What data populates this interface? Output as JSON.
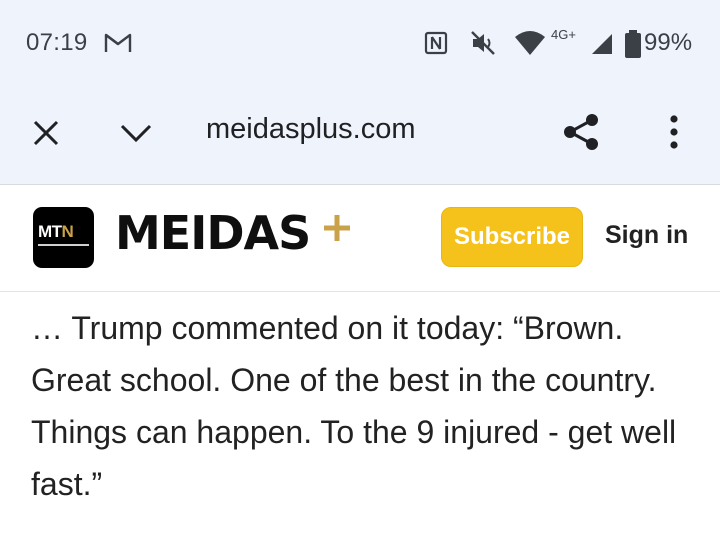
{
  "status_bar": {
    "time": "07:19",
    "network_type": "4G+",
    "battery_percent": "99%",
    "icons": [
      "gmail-icon",
      "nfc-icon",
      "mute-icon",
      "wifi-icon",
      "signal-icon",
      "battery-icon"
    ]
  },
  "browser": {
    "url": "meidasplus.com",
    "close_icon": "close-icon",
    "collapse_icon": "chevron-down-icon",
    "share_icon": "share-icon",
    "menu_icon": "more-vert-icon"
  },
  "site_header": {
    "logo_text_mt": "MT",
    "logo_text_n": "N",
    "brand_name": "MEIDAS",
    "subscribe_label": "Subscribe",
    "signin_label": "Sign in",
    "colors": {
      "subscribe_bg": "#f5c21c",
      "brand_accent": "#c9a24a"
    }
  },
  "article": {
    "text": "… Trump commented on it today: “Brown. Great school. One of the best in the country. Things can happen. To the 9 injured - get well fast.”"
  }
}
